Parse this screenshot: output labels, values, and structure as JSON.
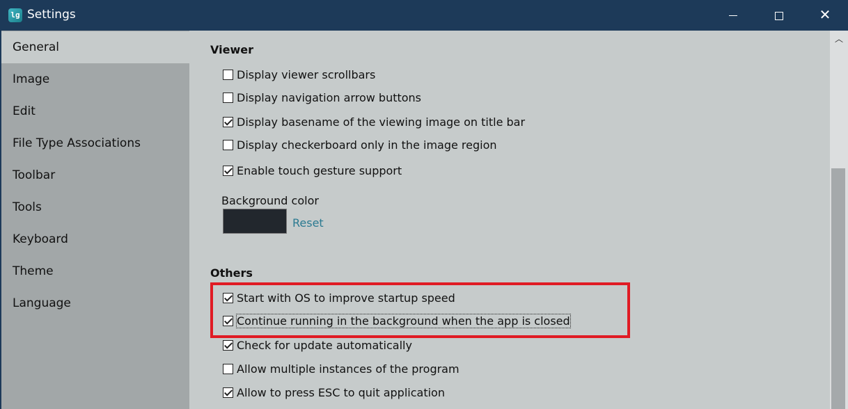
{
  "window": {
    "title": "Settings",
    "icon_text": "lg",
    "controls": {
      "minimize": "minimize-icon",
      "maximize": "maximize-icon",
      "close": "close-icon",
      "close_glyph": "✕"
    }
  },
  "sidebar": {
    "items": [
      {
        "label": "General",
        "active": true
      },
      {
        "label": "Image"
      },
      {
        "label": "Edit"
      },
      {
        "label": "File Type Associations"
      },
      {
        "label": "Toolbar"
      },
      {
        "label": "Tools"
      },
      {
        "label": "Keyboard"
      },
      {
        "label": "Theme"
      },
      {
        "label": "Language"
      }
    ]
  },
  "viewer": {
    "title": "Viewer",
    "options": [
      {
        "label": "Display viewer scrollbars",
        "checked": false
      },
      {
        "label": "Display navigation arrow buttons",
        "checked": false
      },
      {
        "label": "Display basename of the viewing image on title bar",
        "checked": true
      },
      {
        "label": "Display checkerboard only in the image region",
        "checked": false
      },
      {
        "label": "Enable touch gesture support",
        "checked": true
      }
    ],
    "background_color": {
      "label": "Background color",
      "value": "#22272d",
      "reset_label": "Reset"
    }
  },
  "others": {
    "title": "Others",
    "options": [
      {
        "label": "Start with OS to improve startup speed",
        "checked": true
      },
      {
        "label": "Continue running in the background when the app is closed",
        "checked": true,
        "focused": true
      },
      {
        "label": "Check for update automatically",
        "checked": true
      },
      {
        "label": "Allow multiple instances of the program",
        "checked": false
      },
      {
        "label": "Allow to press ESC to quit application",
        "checked": true
      }
    ]
  },
  "scrollbar": {
    "up_glyph": "︿"
  },
  "colors": {
    "titlebar": "#1d3a59",
    "sidebar": "#a2a7a8",
    "content": "#c6cbcb",
    "highlight": "#e01b24",
    "link": "#2b7a91"
  }
}
